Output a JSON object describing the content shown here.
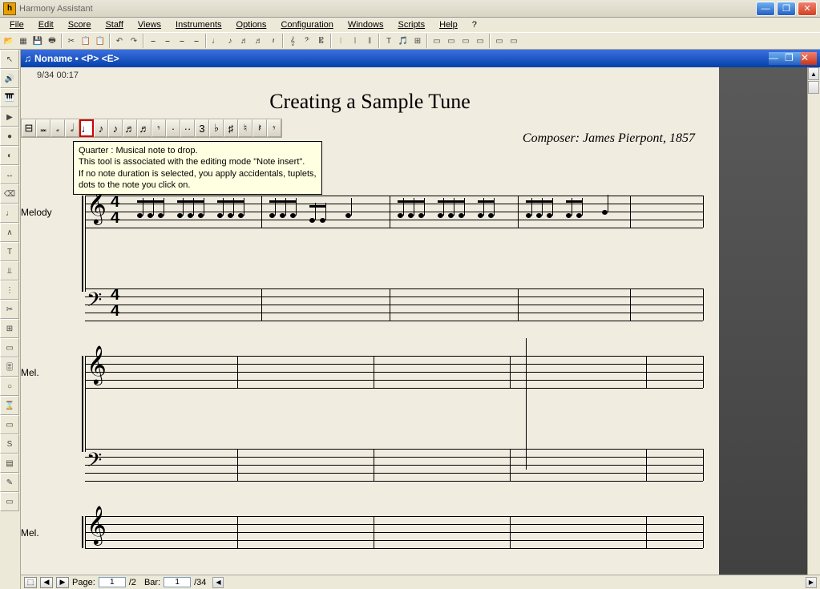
{
  "app": {
    "title": "Harmony Assistant",
    "icon_letter": "h"
  },
  "menu": [
    "File",
    "Edit",
    "Score",
    "Staff",
    "Views",
    "Instruments",
    "Options",
    "Configuration",
    "Windows",
    "Scripts",
    "Help",
    "?"
  ],
  "doc": {
    "title": "Noname • <P> <E>"
  },
  "sheet": {
    "stamp": "9/34 00:17",
    "title": "Creating a Sample Tune",
    "composer": "Composer: James Pierpont, 1857",
    "staff1_label": "Melody",
    "staff2_label": "Mel.",
    "staff3_label": "Mel.",
    "timesig_num": "4",
    "timesig_den": "4"
  },
  "palette": {
    "items": [
      "⊟",
      "𝅜",
      "𝅗",
      "𝅗𝅥",
      "♩",
      "♪",
      "♪",
      "♬",
      "♬",
      "𝄾",
      "·",
      "··",
      "3",
      "♭",
      "♯",
      "♮",
      "𝄽",
      "𝄾"
    ],
    "selected_index": 4
  },
  "tooltip": {
    "line1": "Quarter : Musical note to drop.",
    "line2": " This tool is associated with the editing mode \"Note insert\".",
    "line3": "If no note duration is selected, you apply accidentals, tuplets,",
    "line4": "dots to the note you click on."
  },
  "status": {
    "page_label": "Page:",
    "page_cur": "1",
    "page_total": "/2",
    "bar_label": "Bar:",
    "bar_cur": "1",
    "bar_total": "/34"
  },
  "left_tools": [
    "↖",
    "🔊",
    "🎹",
    "▶",
    "●",
    "◐",
    "↔",
    "⌫",
    "♩",
    "∧",
    "T",
    "⫫",
    "⋮",
    "✂",
    "⊞",
    "▭",
    "🎚",
    "○",
    "⌛",
    "▭",
    "S",
    "▤",
    "✎",
    "▭"
  ],
  "main_tools": [
    "📂",
    "▦",
    "💾",
    "🖶",
    "|",
    "✂",
    "📋",
    "📋",
    "|",
    "↶",
    "↷",
    "|",
    "⎯",
    "⎯",
    "⎯",
    "⎯",
    "|",
    "♩",
    "♪",
    "♬",
    "♬",
    "𝄽",
    "|",
    "𝄞",
    "𝄢",
    "𝄡",
    "|",
    "𝄀",
    "𝄁",
    "𝄂",
    "|",
    "T",
    "🎵",
    "⊞",
    "|",
    "▭",
    "▭",
    "▭",
    "▭",
    "|",
    "▭",
    "▭"
  ]
}
